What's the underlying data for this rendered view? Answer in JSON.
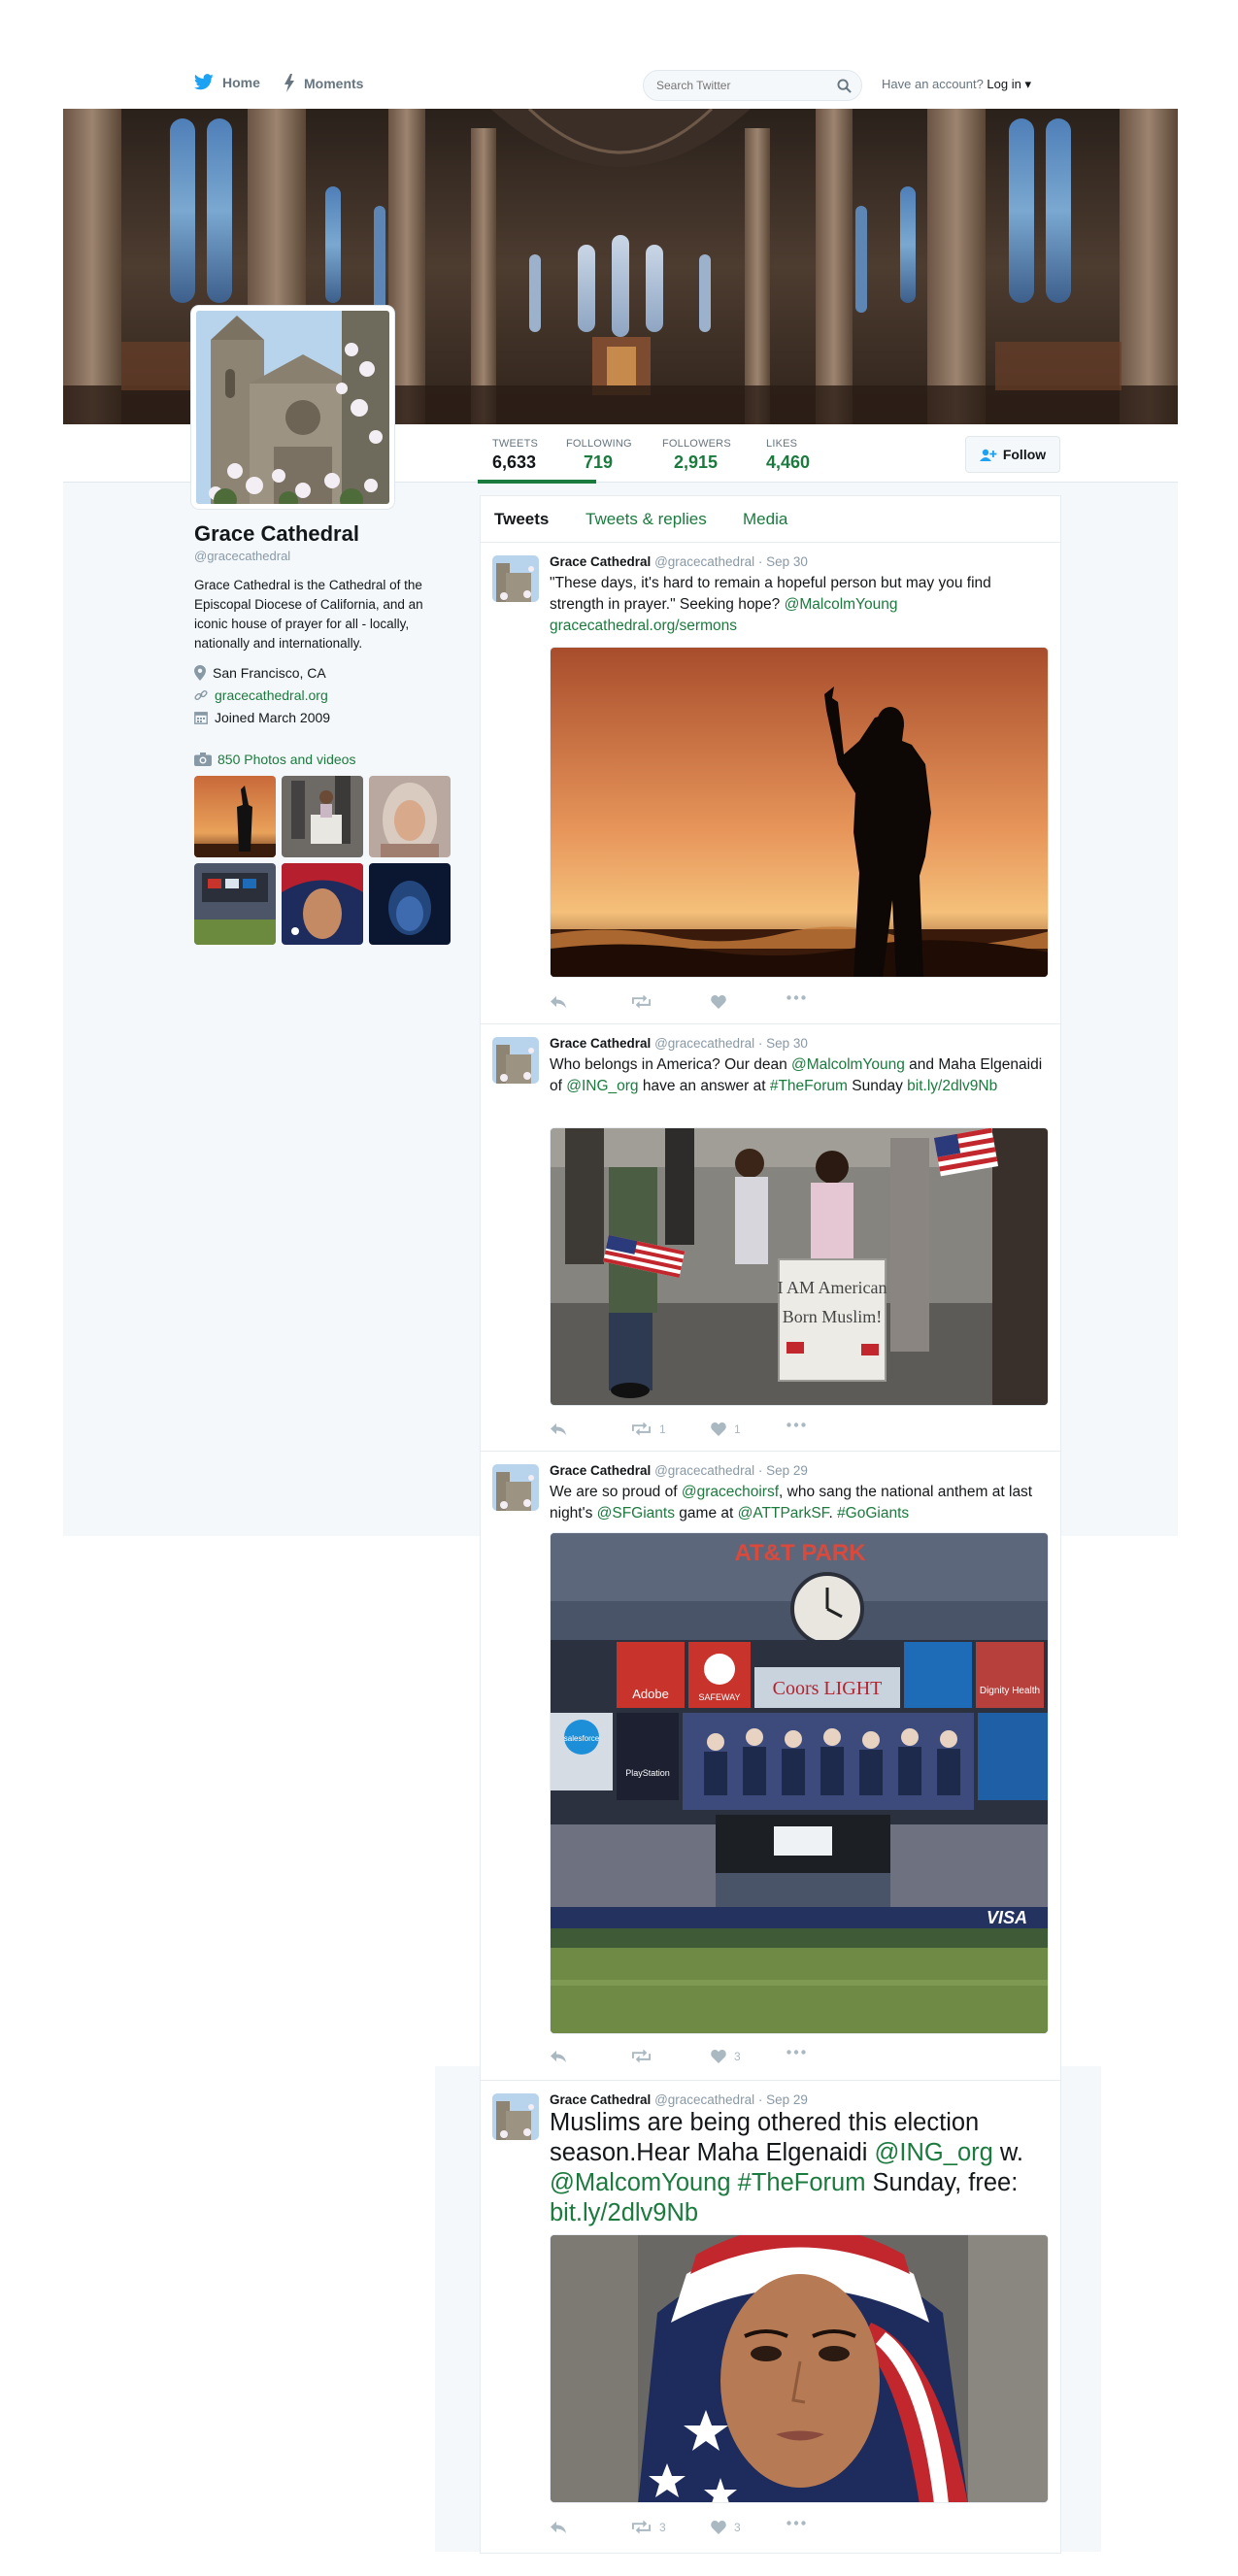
{
  "nav": {
    "home_label": "Home",
    "moments_label": "Moments",
    "search_placeholder": "Search Twitter",
    "account_prompt": "Have an account?",
    "login_label": "Log in ▾"
  },
  "profile": {
    "name": "Grace Cathedral",
    "handle": "@gracecathedral",
    "bio": "Grace Cathedral is the Cathedral of the Episcopal Diocese of California, and an iconic house of prayer for all - locally, nationally and internationally.",
    "location": "San Francisco, CA",
    "website": "gracecathedral.org",
    "joined": "Joined March 2009",
    "photos_link": "850 Photos and videos"
  },
  "stats": [
    {
      "label": "TWEETS",
      "value": "6,633"
    },
    {
      "label": "FOLLOWING",
      "value": "719"
    },
    {
      "label": "FOLLOWERS",
      "value": "2,915"
    },
    {
      "label": "LIKES",
      "value": "4,460"
    }
  ],
  "follow_label": "Follow",
  "tabs": [
    "Tweets",
    "Tweets & replies",
    "Media"
  ],
  "tweets": [
    {
      "name": "Grace Cathedral",
      "meta": "@gracecathedral · Sep 30",
      "text_plain_1": "\"These days, it's hard to remain a hopeful person but may you find strength in prayer.\" Seeking hope? ",
      "mention_1": "@MalcolmYoung",
      "link_1": "gracecathedral.org/sermons",
      "retweets": "",
      "likes": ""
    },
    {
      "name": "Grace Cathedral",
      "meta": "@gracecathedral · Sep 30",
      "text_plain_1": "Who belongs in America? Our dean ",
      "mention_1": "@MalcolmYoung",
      "text_plain_2": "  and Maha Elgenaidi of  ",
      "mention_2": "@ING_org",
      "text_plain_3": " have an answer at ",
      "hashtag_1": "#TheForum",
      "text_plain_4": "  Sunday ",
      "link_1": "bit.ly/2dlv9Nb",
      "retweets": "1",
      "likes": "1",
      "sign_text": "I AM American Born Muslim!"
    },
    {
      "name": "Grace Cathedral",
      "meta": "@gracecathedral · Sep 29",
      "text_plain_1": "We are so proud of ",
      "mention_1": "@gracechoirsf",
      "text_plain_2": ", who sang the national anthem at last night's ",
      "mention_2": "@SFGiants",
      "text_plain_3": " game at ",
      "mention_3": "@ATTParkSF",
      "text_plain_4": ". ",
      "hashtag_1": "#GoGiants",
      "retweets": "",
      "likes": "3",
      "stadium_sign": "AT&T PARK",
      "board_adobe": "Adobe",
      "board_safeway": "SAFEWAY",
      "board_coors": "Coors LIGHT",
      "board_dignity": "Dignity Health",
      "board_playstation": "PlayStation",
      "board_salesforce": "salesforce",
      "board_visa": "VISA"
    },
    {
      "name": "Grace Cathedral",
      "meta": "@gracecathedral · Sep 29",
      "text_plain_1": "Muslims are being othered this election season.Hear Maha Elgenaidi ",
      "mention_1": "@ING_org",
      "text_plain_2": " w. ",
      "mention_2": "@MalcomYoung",
      "text_plain_3": "  ",
      "hashtag_1": "#TheForum",
      "text_plain_4": " Sunday, free: ",
      "link_1": "bit.ly/2dlv9Nb",
      "retweets": "3",
      "likes": "3"
    }
  ],
  "colors": {
    "link": "#1b7a3e",
    "twitter_blue": "#1da1f2",
    "muted": "#8899a6",
    "page_gray": "#f5f8fa"
  }
}
